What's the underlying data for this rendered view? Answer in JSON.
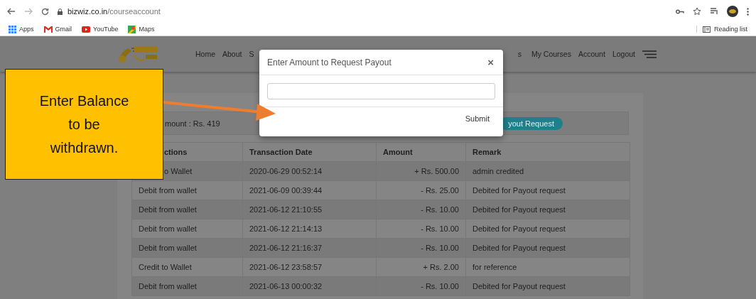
{
  "browser": {
    "url_host": "bizwiz.co.in",
    "url_path": "/courseaccount",
    "bookmarks": [
      "Apps",
      "Gmail",
      "YouTube",
      "Maps"
    ],
    "reading_list": "Reading list"
  },
  "nav": {
    "left_links": [
      "Home",
      "About",
      "S"
    ],
    "right_links": [
      "s",
      "My Courses",
      "Account",
      "Logout"
    ]
  },
  "balance": {
    "text": "mount : Rs. 419",
    "button": "yout Request"
  },
  "table": {
    "columns": [
      "ctions",
      "Transaction Date",
      "Amount",
      "Remark"
    ],
    "first_column_covered": true,
    "rows": [
      {
        "transaction": "o Wallet",
        "covered": true,
        "date": "2020-06-29 00:52:14",
        "amount": "+ Rs. 500.00",
        "remark": "admin credited"
      },
      {
        "transaction": "Debit from wallet",
        "covered": false,
        "date": "2021-06-09 00:39:44",
        "amount": "- Rs. 25.00",
        "remark": "Debited for Payout request"
      },
      {
        "transaction": "Debit from wallet",
        "covered": false,
        "date": "2021-06-12 21:10:55",
        "amount": "- Rs. 10.00",
        "remark": "Debited for Payout request"
      },
      {
        "transaction": "Debit from wallet",
        "covered": false,
        "date": "2021-06-12 21:14:13",
        "amount": "- Rs. 10.00",
        "remark": "Debited for Payout request"
      },
      {
        "transaction": "Debit from wallet",
        "covered": false,
        "date": "2021-06-12 21:16:37",
        "amount": "- Rs. 10.00",
        "remark": "Debited for Payout request"
      },
      {
        "transaction": "Credit to Wallet",
        "covered": false,
        "date": "2021-06-12 23:58:57",
        "amount": "+ Rs. 2.00",
        "remark": "for reference"
      },
      {
        "transaction": "Debit from wallet",
        "covered": false,
        "date": "2021-06-13 00:00:32",
        "amount": "- Rs. 10.00",
        "remark": "Debited for Payout request"
      }
    ]
  },
  "modal": {
    "title": "Enter Amount to Request Payout",
    "close": "×",
    "submit": "Submit"
  },
  "callout": {
    "text": "Enter Balance to be withdrawn."
  }
}
